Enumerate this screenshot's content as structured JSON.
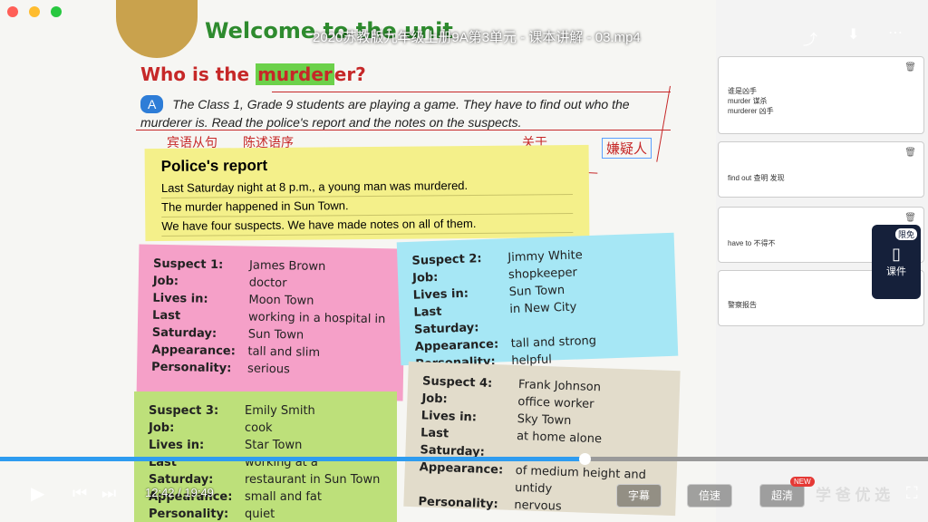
{
  "window": {
    "video_title": "2020苏教版九年级上册9A第3单元 - 课本讲解 - 03.mp4"
  },
  "page": {
    "welcome": "Welcome to the unit",
    "heading_prefix": "Who is the ",
    "heading_highlight": "murder",
    "heading_suffix": "er?",
    "intro_a": "A",
    "intro_text": "The Class 1, Grade 9 students are playing a game. They have to find out who the murderer is. Read the police's report and the notes on the suspects.",
    "annot_1": "宾语从句",
    "annot_2": "陈述语序",
    "annot_3": "关于",
    "annot_4": "嫌疑人",
    "report_title": "Police's report",
    "report_lines": [
      "Last Saturday night at 8 p.m., a young man was murdered.",
      "The murder happened in Sun Town.",
      "We have four suspects. We have made notes on all of them."
    ]
  },
  "suspects": [
    {
      "title": "Suspect 1:",
      "name": "James Brown",
      "job_k": "Job:",
      "job": "doctor",
      "lives_k": "Lives in:",
      "lives": "Moon Town",
      "last_k": "Last Saturday:",
      "last": "working in a hospital in Sun Town",
      "app_k": "Appearance:",
      "app": "tall and slim",
      "pers_k": "Personality:",
      "pers": "serious"
    },
    {
      "title": "Suspect 2:",
      "name": "Jimmy White",
      "job_k": "Job:",
      "job": "shopkeeper",
      "lives_k": "Lives in:",
      "lives": "Sun Town",
      "last_k": "Last Saturday:",
      "last": "in New City",
      "app_k": "Appearance:",
      "app": "tall and strong",
      "pers_k": "Personality:",
      "pers": "helpful"
    },
    {
      "title": "Suspect 3:",
      "name": "Emily Smith",
      "job_k": "Job:",
      "job": "cook",
      "lives_k": "Lives in:",
      "lives": "Star Town",
      "last_k": "Last Saturday:",
      "last": "working at a restaurant in Sun Town",
      "app_k": "Appearance:",
      "app": "small and fat",
      "pers_k": "Personality:",
      "pers": "quiet"
    },
    {
      "title": "Suspect 4:",
      "name": "Frank Johnson",
      "job_k": "Job:",
      "job": "office worker",
      "lives_k": "Lives in:",
      "lives": "Sky Town",
      "last_k": "Last Saturday:",
      "last": "at home alone",
      "app_k": "Appearance:",
      "app": "of medium height and untidy",
      "pers_k": "Personality:",
      "pers": "nervous"
    }
  ],
  "notes": [
    {
      "lines": [
        "谁是凶手",
        "murder  谋杀",
        "murderer  凶手"
      ]
    },
    {
      "lines": [
        "find out  查明 发现"
      ]
    },
    {
      "lines": [
        "have to  不得不"
      ]
    },
    {
      "lines": [
        "警察报告"
      ]
    }
  ],
  "courseware": {
    "badge": "限免",
    "label": "课件"
  },
  "player": {
    "time": "12:42 / 19:49",
    "progress": 0.63,
    "subtitle_btn": "字幕",
    "speed_btn": "倍速",
    "quality_btn": "超清",
    "new_badge": "NEW",
    "brand": "学 爸 优 选"
  }
}
